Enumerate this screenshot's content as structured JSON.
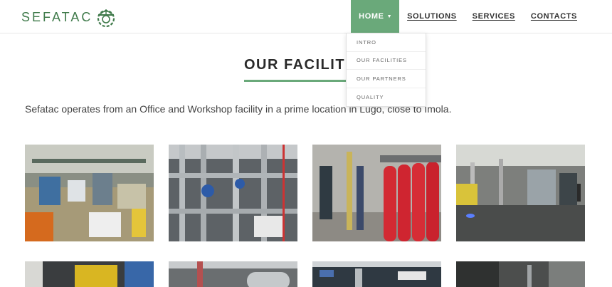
{
  "brand": {
    "logo_text": "SEFATAC",
    "accent_color": "#6aa97a",
    "logo_color": "#3f7a4a"
  },
  "nav": {
    "items": [
      {
        "label": "HOME",
        "active": true,
        "has_dropdown": true
      },
      {
        "label": "SOLUTIONS"
      },
      {
        "label": "SERVICES"
      },
      {
        "label": "CONTACTS"
      }
    ]
  },
  "dropdown": {
    "items": [
      "INTRO",
      "OUR FACILITIES",
      "OUR PARTNERS",
      "QUALITY"
    ]
  },
  "section": {
    "title": "OUR FACILITIES",
    "intro": "Sefatac operates from an Office and Workshop facility in a prime location in Lugo, close to Imola."
  },
  "gallery": {
    "photos": [
      "workshop-floor-photo",
      "piping-assembly-photo",
      "fire-extinguisher-cylinders-photo",
      "test-hall-photo",
      "machinery-photo-5",
      "piping-photo-6",
      "pipework-photo-7",
      "equipment-photo-8"
    ]
  }
}
